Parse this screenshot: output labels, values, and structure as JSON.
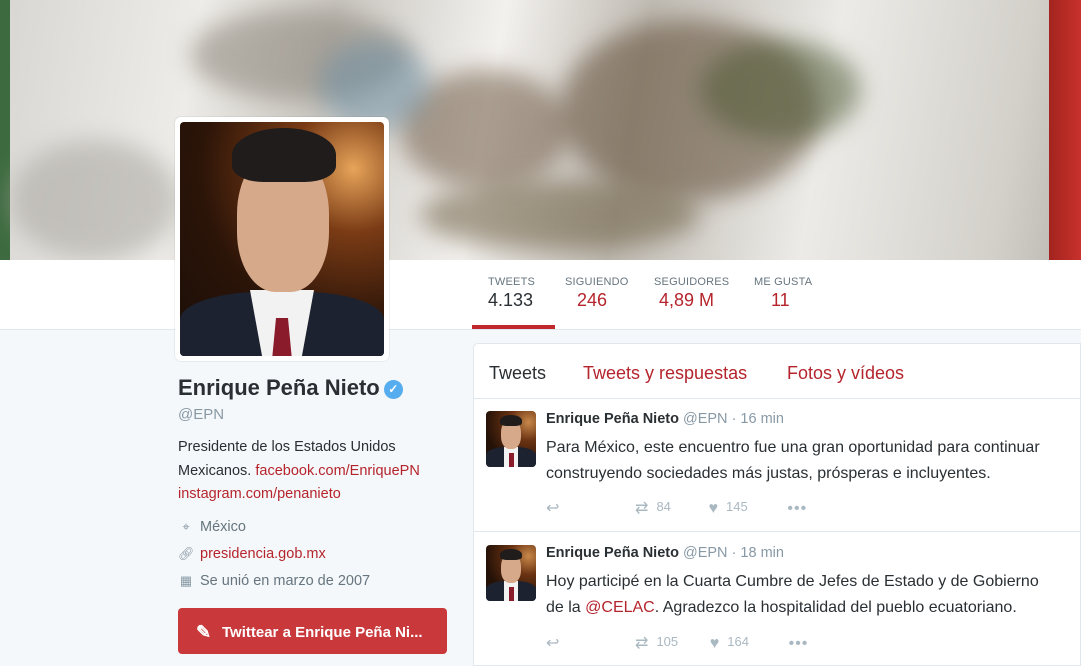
{
  "profile": {
    "name": "Enrique Peña Nieto",
    "handle": "@EPN",
    "bio_text": "Presidente de los Estados Unidos Mexicanos.",
    "bio_link1": "facebook.com/EnriquePN",
    "bio_link2": "instagram.com/penanieto",
    "location": "México",
    "website": "presidencia.gob.mx",
    "joined": "Se unió en marzo de 2007",
    "tweet_button": "Twittear a Enrique Peña Ni..."
  },
  "stats": [
    {
      "label": "TWEETS",
      "value": "4.133"
    },
    {
      "label": "SIGUIENDO",
      "value": "246"
    },
    {
      "label": "SEGUIDORES",
      "value": "4,89 M"
    },
    {
      "label": "ME GUSTA",
      "value": "11"
    }
  ],
  "tabs": [
    "Tweets",
    "Tweets y respuestas",
    "Fotos y vídeos"
  ],
  "tweets": [
    {
      "author": "Enrique Peña Nieto",
      "handle": "@EPN",
      "time": "· 16 min",
      "line1": "Para México, este encuentro fue una gran oportunidad para continuar",
      "line2": "construyendo sociedades más justas, prósperas e incluyentes.",
      "retweets": "84",
      "likes": "145"
    },
    {
      "author": "Enrique Peña Nieto",
      "handle": "@EPN",
      "time": "· 18 min",
      "line1": "Hoy participé en la Cuarta Cumbre de Jefes de Estado y de Gobierno",
      "line2_pre": "de la ",
      "line2_mention": "@CELAC",
      "line2_post": ". Agradezco la hospitalidad del pueblo ecuatoriano.",
      "retweets": "105",
      "likes": "164"
    }
  ],
  "icons": {
    "verified": "verified-check-icon",
    "location": "map-pin-icon",
    "link": "link-icon",
    "calendar": "calendar-icon",
    "quill": "quill-icon",
    "reply": "reply-icon",
    "retweet": "retweet-icon",
    "like": "heart-icon",
    "more": "more-icon"
  },
  "colors": {
    "accent": "#b5242c",
    "button": "#c9393c",
    "verified": "#55acee"
  }
}
